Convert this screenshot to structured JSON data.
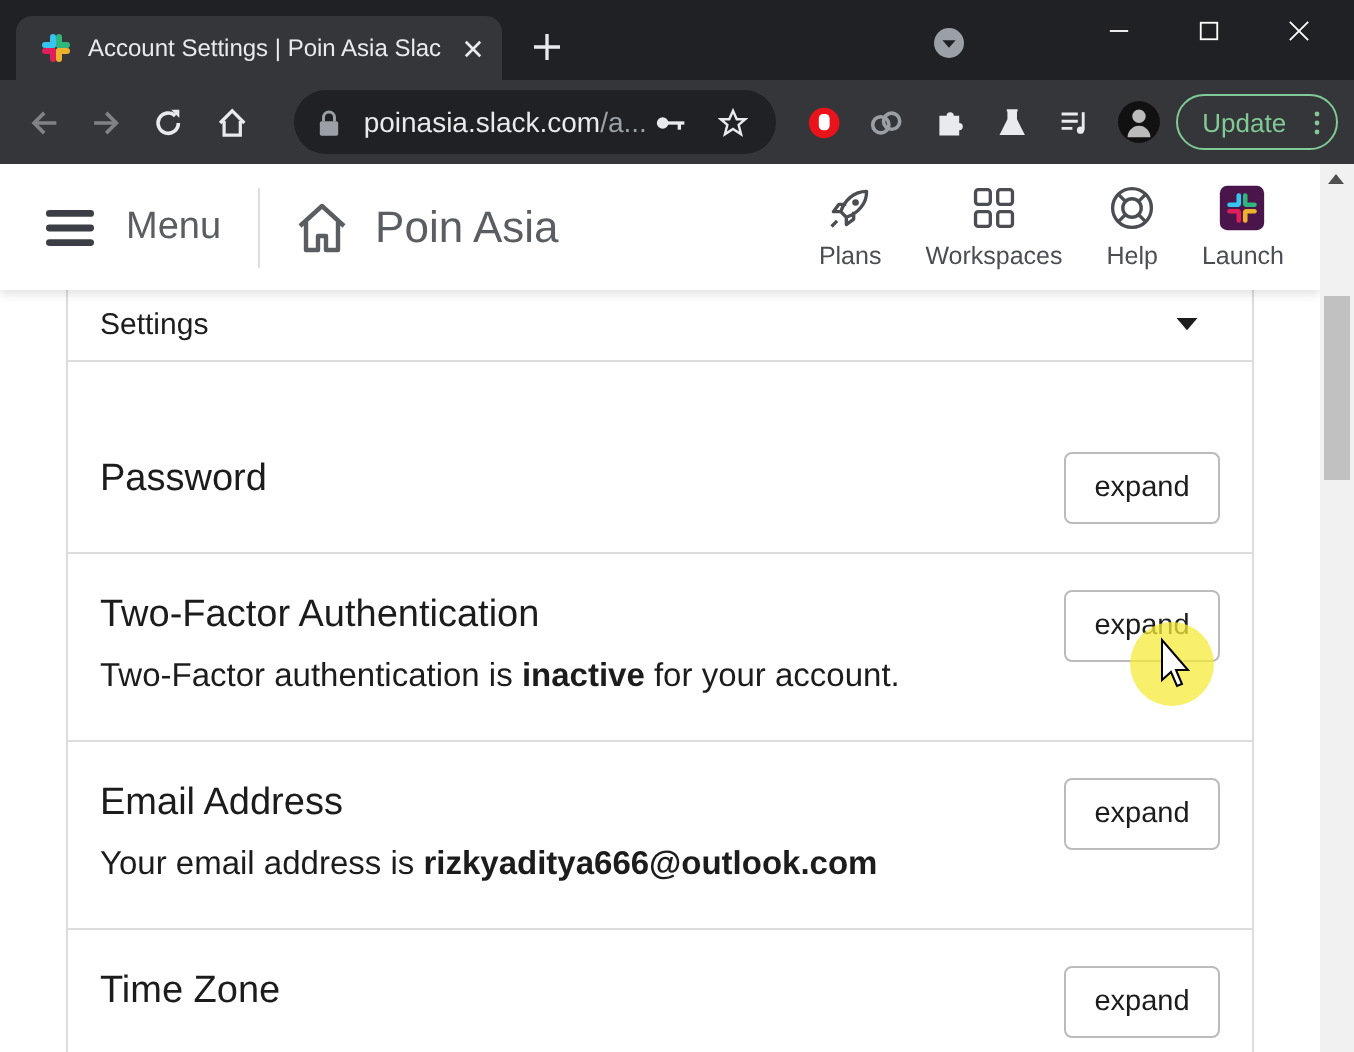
{
  "browser": {
    "tab_title": "Account Settings | Poin Asia Slac",
    "url_host": "poinasia.slack.com",
    "url_rest": "/a...",
    "update_label": "Update"
  },
  "header": {
    "menu_label": "Menu",
    "workspace": "Poin Asia",
    "nav": [
      {
        "kind": "rocket",
        "label": "Plans"
      },
      {
        "kind": "grid",
        "label": "Workspaces"
      },
      {
        "kind": "help",
        "label": "Help"
      },
      {
        "kind": "launch",
        "label": "Launch"
      }
    ]
  },
  "settings": {
    "title": "Settings",
    "expanded": true,
    "rows": [
      {
        "title": "Password",
        "button": "expand"
      },
      {
        "title": "Two-Factor Authentication",
        "description": "Two-Factor authentication is **inactive** for your account.",
        "button": "expand"
      },
      {
        "title": "Email Address",
        "description": "Your email address is **rizkyaditya666@outlook.com**",
        "button": "expand"
      },
      {
        "title": "Time Zone",
        "button": "expand"
      }
    ]
  }
}
